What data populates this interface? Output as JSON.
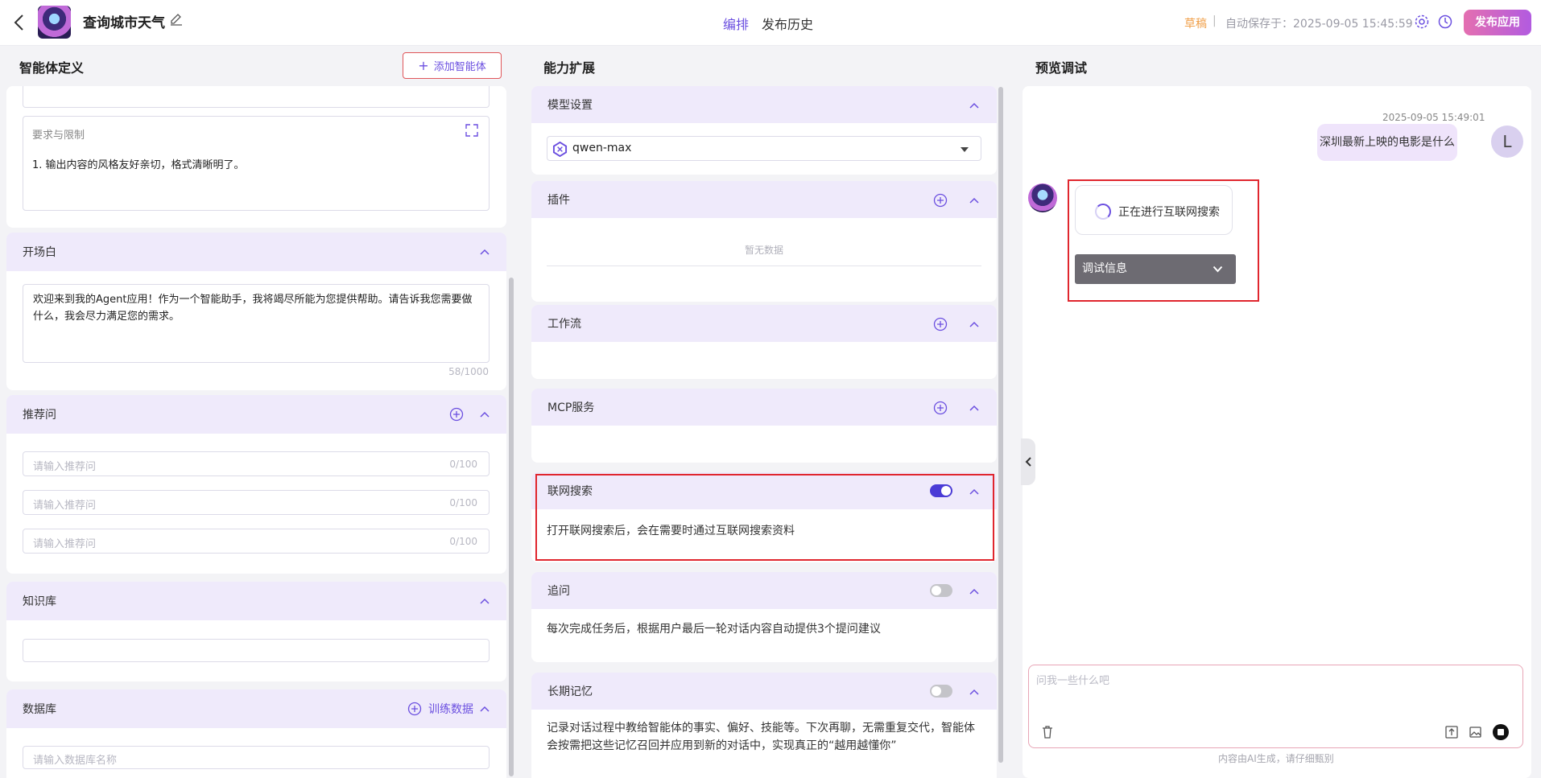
{
  "header": {
    "app_title": "查询城市天气",
    "tabs": [
      "编排",
      "发布历史"
    ],
    "draft_status": "草稿",
    "separator": "|",
    "autosave": "自动保存于：2025-09-05 15:45:59",
    "publish_label": "发布应用",
    "accent_color": "#6b4fe0"
  },
  "left": {
    "title": "智能体定义",
    "add_agent_label": "添加智能体",
    "requirements": {
      "label": "要求与限制",
      "content": "1. 输出内容的风格友好亲切，格式清晰明了。"
    },
    "opening": {
      "title": "开场白",
      "content": "欢迎来到我的Agent应用！作为一个智能助手，我将竭尽所能为您提供帮助。请告诉我您需要做什么，我会尽力满足您的需求。",
      "counter": "58/1000"
    },
    "recommend": {
      "title": "推荐问",
      "inputs": [
        {
          "placeholder": "请输入推荐问",
          "counter": "0/100"
        },
        {
          "placeholder": "请输入推荐问",
          "counter": "0/100"
        },
        {
          "placeholder": "请输入推荐问",
          "counter": "0/100"
        }
      ]
    },
    "knowledge": {
      "title": "知识库"
    },
    "database": {
      "title": "数据库",
      "train_label": "训练数据",
      "placeholder": "请输入数据库名称"
    }
  },
  "middle": {
    "title": "能力扩展",
    "model": {
      "title": "模型设置",
      "selected": "qwen-max"
    },
    "plugins": {
      "title": "插件",
      "empty": "暂无数据"
    },
    "workflow": {
      "title": "工作流"
    },
    "mcp": {
      "title": "MCP服务"
    },
    "web_search": {
      "title": "联网搜索",
      "enabled": true,
      "desc": "打开联网搜索后，会在需要时通过互联网搜索资料"
    },
    "followup": {
      "title": "追问",
      "enabled": false,
      "desc": "每次完成任务后，根据用户最后一轮对话内容自动提供3个提问建议"
    },
    "memory": {
      "title": "长期记忆",
      "enabled": false,
      "desc_line1": "记录对话过程中教给智能体的事实、偏好、技能等。下次再聊，无需重复交代，智能体",
      "desc_line2": "会按需把这些记忆召回并应用到新的对话中，实现真正的“越用越懂你”"
    }
  },
  "right": {
    "title": "预览调试",
    "timestamp": "2025-09-05 15:49:01",
    "user_message": "深圳最新上映的电影是什么",
    "user_initial": "L",
    "bot_status": "正在进行互联网搜索",
    "debug_label": "调试信息",
    "input_placeholder": "问我一些什么吧",
    "disclaimer": "内容由AI生成，请仔细甄别"
  }
}
